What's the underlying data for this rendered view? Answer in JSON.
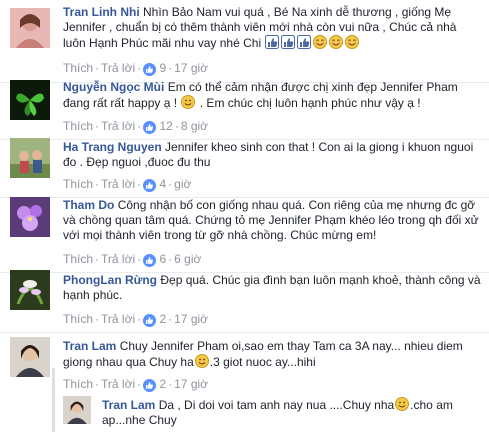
{
  "comments": [
    {
      "author": "Tran Linh Nhi",
      "text": "Nhìn Bảo Nam vui quá , Bé Na xinh dễ thương , giống Mẹ Jennifer , chuẩn bị có thêm thành viên mới nhà còn vui nữa , Chúc cả nhà luôn Hạnh Phúc mãi nhu vay nhé Chi",
      "like_label": "Thích",
      "reply_label": "Trả lời",
      "likes": "9",
      "time": "17 giờ",
      "emoji": [
        "like-emoji",
        "like-emoji",
        "like-emoji",
        "blush-emoji",
        "blush-emoji",
        "blush-emoji"
      ]
    },
    {
      "author": "Nguyễn Ngọc Mùi",
      "text": "Em có thể cảm nhận được chị xinh đẹp Jennifer Pham đang rất rất happy ạ !",
      "text_after": ". Em chúc chị luôn hạnh phúc như vậy ạ !",
      "like_label": "Thích",
      "reply_label": "Trả lời",
      "likes": "12",
      "time": "8 giờ"
    },
    {
      "author": "Ha Trang Nguyen",
      "text": "Jennifer kheo sinh con that ! Con ai la giong i khuon nguoi đo . Đẹp nguoi ,đuoc đu thu",
      "like_label": "Thích",
      "reply_label": "Trả lời",
      "likes": "4",
      "time": "giờ"
    },
    {
      "author": "Tham Do",
      "text": "Công nhận bố con giống nhau quá. Con riêng của mẹ nhưng đc gỡ và chồng quan tâm quá. Chứng tỏ mẹ Jennifer Phạm khéo léo trong qh đối xử với mọi thành viên trong từ gỡ nhà chồng. Chúc mừng em!",
      "like_label": "Thích",
      "reply_label": "Trả lời",
      "likes": "6",
      "time": "6 giờ"
    },
    {
      "author": "PhongLan Rừng",
      "text": "Đẹp quá. Chúc gia đình bạn luôn mạnh khoẻ, thành công và hạnh phúc.",
      "like_label": "Thích",
      "reply_label": "Trả lời",
      "likes": "2",
      "time": "17 giờ"
    },
    {
      "author": "Tran Lam",
      "text": "Chuy Jennifer Pham oi,sao em thay Tam ca 3A nay... nhieu diem giong nhau qua Chuy ha",
      "text_after": ".3 giot nuoc ay...hihi",
      "like_label": "Thích",
      "reply_label": "Trả lời",
      "likes": "2",
      "time": "17 giờ"
    }
  ],
  "reply": {
    "author": "Tran Lam",
    "text": "Da , Di doi voi tam anh nay nua ....Chuy nha",
    "text_after": ".cho am ap...nhe Chuy"
  },
  "colors": {
    "name": "#365899",
    "meta": "#90949c",
    "text": "#1d2129",
    "like_badge": "#5890ff",
    "emoji_face": "#f7c948"
  }
}
